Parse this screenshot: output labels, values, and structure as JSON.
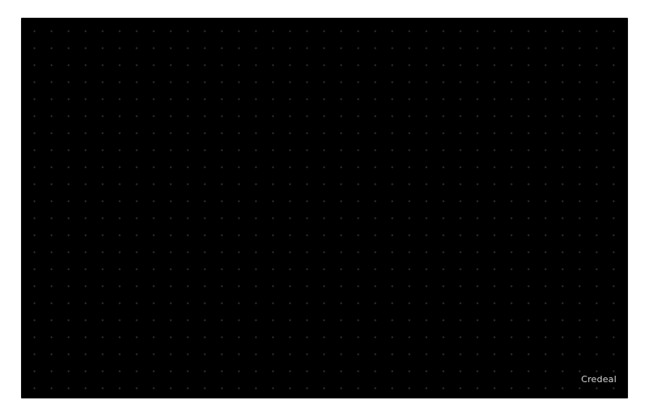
{
  "product": {
    "brand": "Credeal",
    "colors": {
      "board": "#000000",
      "dots": "#969696",
      "brand_text": "#d8d8d8",
      "background": "#ffffff"
    }
  }
}
